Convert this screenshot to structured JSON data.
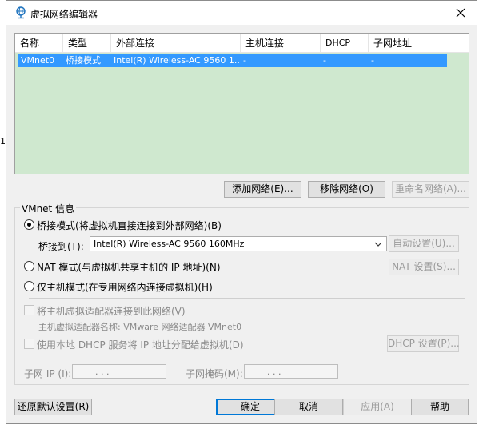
{
  "window": {
    "title": "虚拟网络编辑器",
    "side_mark": "1"
  },
  "list": {
    "columns": [
      "名称",
      "类型",
      "外部连接",
      "主机连接",
      "DHCP",
      "子网地址"
    ],
    "rows": [
      {
        "name": "VMnet0",
        "type": "桥接模式",
        "external": "Intel(R) Wireless-AC 9560 1...",
        "host": "-",
        "dhcp": "-",
        "subnet": "-"
      }
    ]
  },
  "list_buttons": {
    "add": "添加网络(E)...",
    "remove": "移除网络(O)",
    "rename": "重命名网络(A)..."
  },
  "vmnet_info": {
    "legend": "VMnet 信息",
    "bridged_label": "桥接模式(将虚拟机直接连接到外部网络)(B)",
    "bridged_to_label": "桥接到(T):",
    "bridged_to_value": "Intel(R) Wireless-AC 9560 160MHz",
    "auto_settings": "自动设置(U)...",
    "nat_label": "NAT 模式(与虚拟机共享主机的 IP 地址)(N)",
    "nat_settings": "NAT 设置(S)...",
    "hostonly_label": "仅主机模式(在专用网络内连接虚拟机)(H)",
    "connect_adapter_label": "将主机虚拟适配器连接到此网络(V)",
    "adapter_name": "主机虚拟适配器名称: VMware 网络适配器 VMnet0",
    "dhcp_label": "使用本地 DHCP 服务将 IP 地址分配给虚拟机(D)",
    "dhcp_settings": "DHCP 设置(P)...",
    "subnet_ip_label": "子网 IP (I):",
    "subnet_mask_label": "子网掩码(M):",
    "ip_dots": ".   .   ."
  },
  "footer": {
    "restore": "还原默认设置(R)",
    "ok": "确定",
    "cancel": "取消",
    "apply": "应用(A)",
    "help": "帮助"
  },
  "colors": {
    "list_bg": "#cfe8cf",
    "selection": "#3399ff",
    "accent": "#0078d7"
  },
  "icons": {
    "app": "network-globe-icon",
    "close": "close-icon",
    "dropdown": "chevron-down-icon"
  }
}
